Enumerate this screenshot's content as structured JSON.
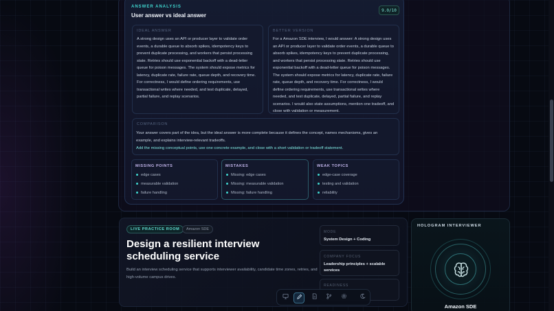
{
  "analysis": {
    "kicker": "ANSWER ANALYSIS",
    "title": "User answer vs ideal answer",
    "score": "9.0/10",
    "ideal": {
      "label": "IDEAL ANSWER",
      "text": "A strong design uses an API or producer layer to validate order events, a durable queue to absorb spikes, idempotency keys to prevent duplicate processing, and workers that persist processing state. Retries should use exponential backoff with a dead-letter queue for poison messages. The system should expose metrics for latency, duplicate rate, failure rate, queue depth, and recovery time. For correctness, I would define ordering requirements, use transactional writes where needed, and test duplicate, delayed, partial failure, and replay scenarios."
    },
    "better": {
      "label": "BETTER VERSION",
      "text": "For a Amazon SDE interview, I would answer: A strong design uses an API or producer layer to validate order events, a durable queue to absorb spikes, idempotency keys to prevent duplicate processing, and workers that persist processing state. Retries should use exponential backoff with a dead-letter queue for poison messages. The system should expose metrics for latency, duplicate rate, failure rate, queue depth, and recovery time. For correctness, I would define ordering requirements, use transactional writes where needed, and test duplicate, delayed, partial failure, and replay scenarios. I would also state assumptions, mention one tradeoff, and close with validation or measurement."
    },
    "comparison": {
      "label": "COMPARISON",
      "text": "Your answer covers part of the idea, but the ideal answer is more complete because it defines the concept, names mechanisms, gives an example, and explains interview-relevant tradeoffs.",
      "tip": "Add the missing conceptual points, use one concrete example, and close with a short validation or tradeoff statement."
    },
    "missing": {
      "title": "MISSING POINTS",
      "items": [
        "edge cases",
        "measurable validation",
        "failure handling"
      ]
    },
    "mistakes": {
      "title": "MISTAKES",
      "items": [
        "Missing: edge cases",
        "Missing: measurable validation",
        "Missing: failure handling"
      ]
    },
    "weak": {
      "title": "WEAK TOPICS",
      "items": [
        "edge-case coverage",
        "testing and validation",
        "reliability"
      ]
    }
  },
  "practice": {
    "live_tag": "LIVE PRACTICE ROOM",
    "company_tag": "Amazon SDE",
    "headline": "Design a resilient interview scheduling service",
    "description": "Build an interview scheduling service that supports interviewer availability, candidate time zones, retries, and high-volume campus drives.",
    "mode": {
      "label": "MODE",
      "value": "System Design + Coding"
    },
    "company_focus": {
      "label": "COMPANY FOCUS",
      "value": "Leadership principles + scalable services"
    },
    "readiness": {
      "label": "READINESS",
      "value": ""
    }
  },
  "dock": {
    "icons": [
      "monitor-icon",
      "pen-icon",
      "document-icon",
      "branch-icon",
      "gear-icon",
      "moon-icon"
    ],
    "active": "pen-icon"
  },
  "hologram": {
    "title": "HOLOGRAM INTERVIEWER",
    "name": "Amazon SDE",
    "icon": "brain-icon",
    "accent": "#3fd6cf"
  }
}
